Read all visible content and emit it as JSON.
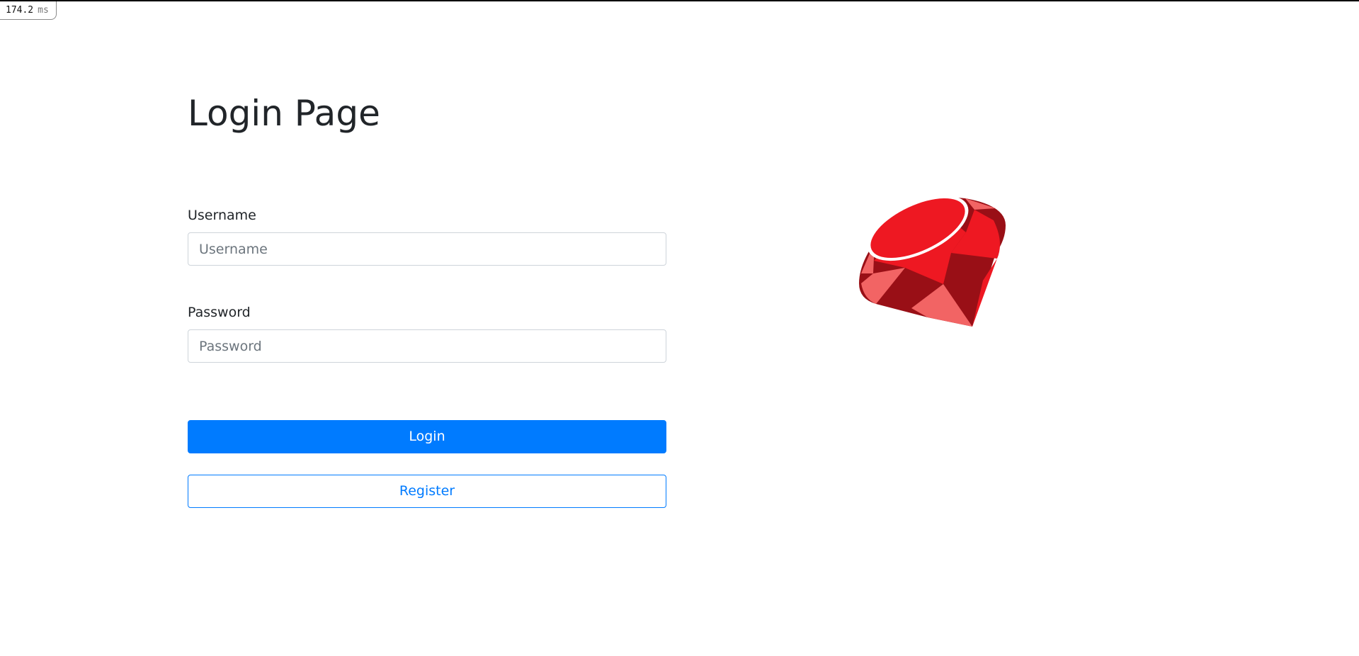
{
  "timing": {
    "value": "174.2",
    "unit": "ms"
  },
  "page": {
    "title": "Login Page"
  },
  "form": {
    "username": {
      "label": "Username",
      "placeholder": "Username",
      "value": ""
    },
    "password": {
      "label": "Password",
      "placeholder": "Password",
      "value": ""
    },
    "login_label": "Login",
    "register_label": "Register"
  },
  "logo": {
    "icon": "ruby-gem-icon"
  },
  "colors": {
    "primary": "#007bff",
    "ruby_red": "#ee1822",
    "ruby_dark": "#990f16",
    "ruby_light": "#f26464"
  }
}
